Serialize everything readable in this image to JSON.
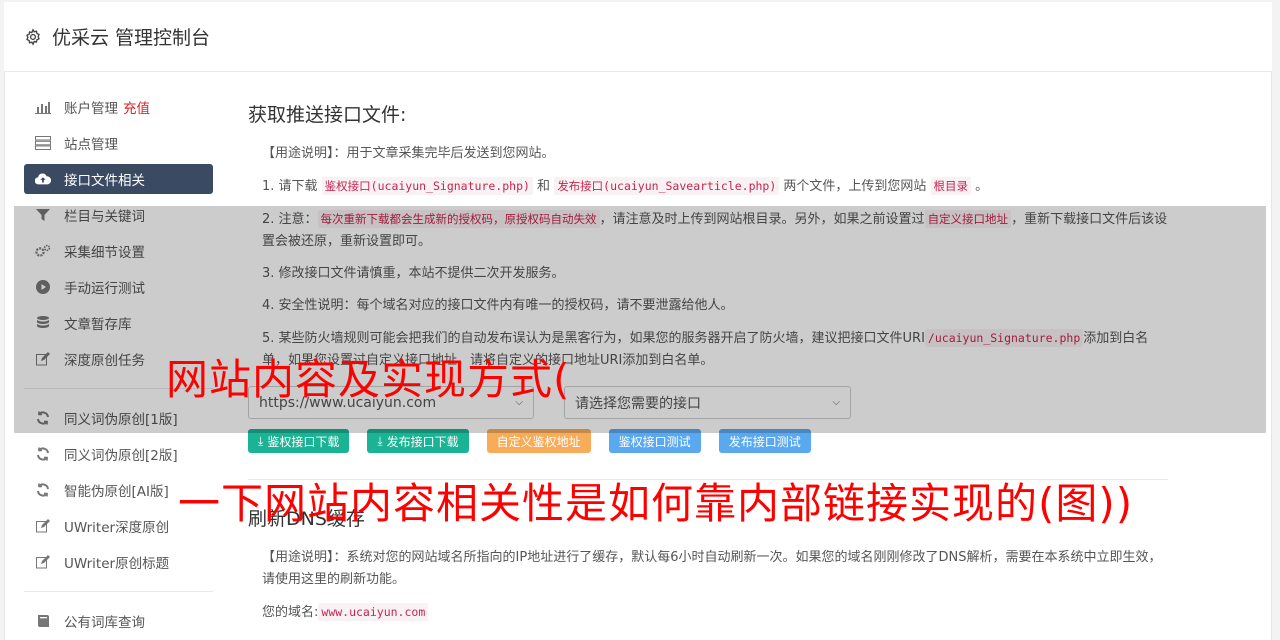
{
  "header": {
    "title": "优采云 管理控制台"
  },
  "sidebar": {
    "items": [
      {
        "label": "账户管理",
        "extra": "充值",
        "icon": "bar-chart-icon"
      },
      {
        "label": "站点管理",
        "icon": "server-icon"
      },
      {
        "label": "接口文件相关",
        "icon": "cloud-upload-icon",
        "active": true
      },
      {
        "label": "栏目与关键词",
        "icon": "filter-icon"
      },
      {
        "label": "采集细节设置",
        "icon": "gears-icon"
      },
      {
        "label": "手动运行测试",
        "icon": "play-circle-icon"
      },
      {
        "label": "文章暂存库",
        "icon": "database-icon"
      },
      {
        "label": "深度原创任务",
        "icon": "edit-icon"
      },
      {
        "label": "同义词伪原创[1版]",
        "icon": "refresh-icon"
      },
      {
        "label": "同义词伪原创[2版]",
        "icon": "refresh-icon"
      },
      {
        "label": "智能伪原创[AI版]",
        "icon": "refresh-icon"
      },
      {
        "label": "UWriter深度原创",
        "icon": "edit-icon"
      },
      {
        "label": "UWriter原创标题",
        "icon": "edit-icon"
      },
      {
        "label": "公有词库查询",
        "icon": "book-icon"
      }
    ]
  },
  "main": {
    "section1": {
      "title": "获取推送接口文件:",
      "usage_label": "【用途说明】",
      "usage_text": "：用于文章采集完毕后发送到您网站。",
      "step1_a": "1. 请下载 ",
      "step1_code1": "鉴权接口(ucaiyun_Signature.php)",
      "step1_b": " 和 ",
      "step1_code2": "发布接口(ucaiyun_Savearticle.php)",
      "step1_c": " 两个文件，上传到您网站 ",
      "step1_code3": "根目录",
      "step1_d": " 。",
      "step2_a": "2. 注意：",
      "step2_code1": "每次重新下载都会生成新的授权码，原授权码自动失效",
      "step2_b": "，请注意及时上传到网站根目录。另外，如果之前设置过",
      "step2_code2": "自定义接口地址",
      "step2_c": "，重新下载接口文件后该设置会被还原，重新设置即可。",
      "step3": "3. 修改接口文件请慎重，本站不提供二次开发服务。",
      "step4": "4. 安全性说明：每个域名对应的接口文件内有唯一的授权码，请不要泄露给他人。",
      "step5_a": "5. 某些防火墙规则可能会把我们的自动发布误认为是黑客行为，如果您的服务器开启了防火墙，建议把接口文件URI",
      "step5_code": "/ucaiyun_Signature.php",
      "step5_b": "添加到白名单，如果您设置过自定义接口地址，请将自定义的接口地址URI添加到白名单。",
      "select_site": "https://www.ucaiyun.com",
      "select_api": "请选择您需要的接口",
      "buttons": {
        "auth_download": "鉴权接口下载",
        "publish_download": "发布接口下载",
        "custom_auth": "自定义鉴权地址",
        "auth_test": "鉴权接口测试",
        "publish_test": "发布接口测试"
      }
    },
    "section2": {
      "title": "刷新DNS缓存",
      "usage_label": "【用途说明】",
      "usage_text": "：系统对您的网站域名所指向的IP地址进行了缓存，默认每6小时自动刷新一次。如果您的域名刚刚修改了DNS解析，需要在本系统中立即生效，请使用这里的刷新功能。",
      "domain_label": "您的域名:",
      "domain_value": "www.ucaiyun.com"
    }
  },
  "watermark": {
    "line1": "网站内容及实现方式(",
    "line2": "一下网站内容相关性是如何靠内部链接实现的(图))"
  },
  "colors": {
    "active_nav": "#3b4a63",
    "green": "#1ab394",
    "orange": "#f8ac59",
    "blue": "#5aa9f0",
    "watermark": "#ff0000"
  }
}
